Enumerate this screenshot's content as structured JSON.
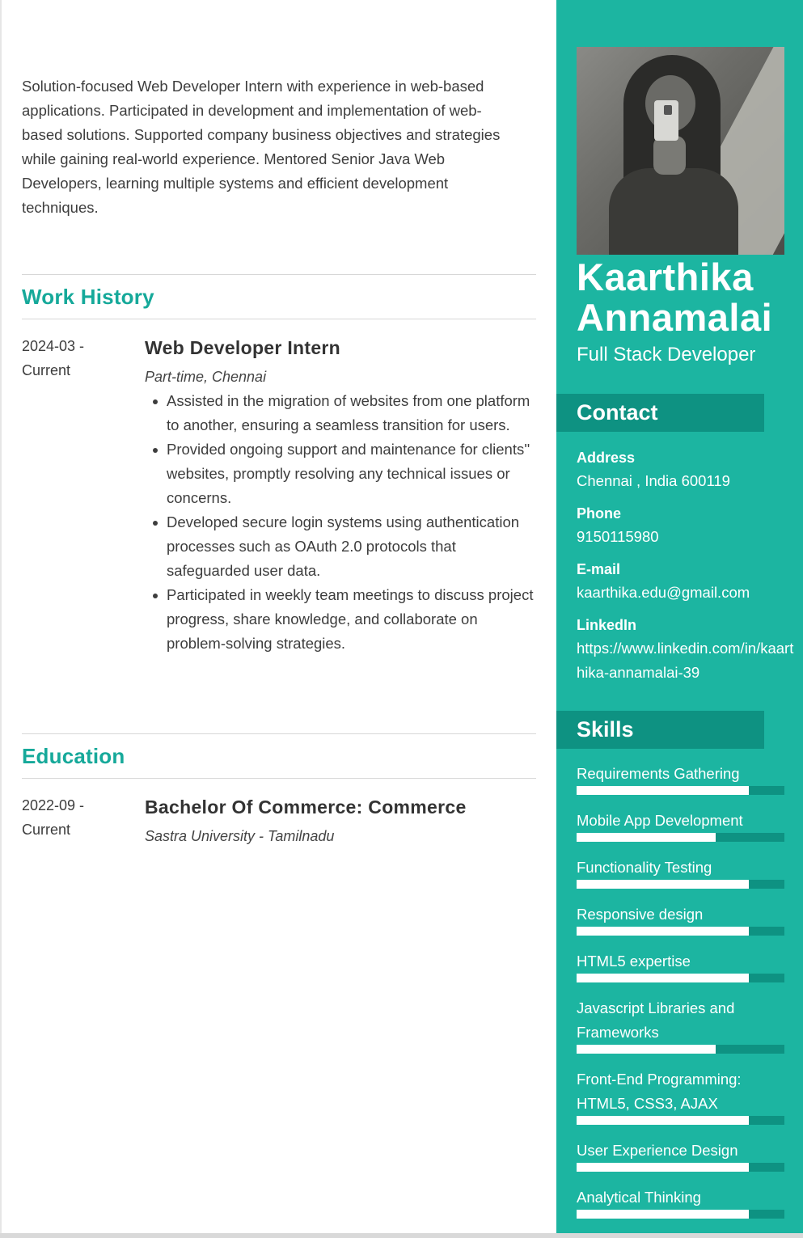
{
  "summary": "Solution-focused Web Developer Intern with experience in web-based applications. Participated in development and implementation of web-based solutions. Supported company business objectives and strategies while gaining real-world experience. Mentored Senior Java Web Developers, learning multiple systems and efficient development techniques.",
  "work": {
    "heading": "Work History",
    "date": "2024-03 - Current",
    "title": "Web Developer Intern",
    "subtitle": "Part-time, Chennai",
    "bullets": [
      "Assisted in the migration of websites from one platform to another, ensuring a seamless transition for users.",
      "Provided ongoing support and maintenance for clients'' websites, promptly resolving any technical issues or concerns.",
      "Developed secure login systems using authentication processes such as OAuth 2.0 protocols that safeguarded user data.",
      "Participated in weekly team meetings to discuss project progress, share knowledge, and collaborate on problem-solving strategies."
    ]
  },
  "education": {
    "heading": "Education",
    "date": "2022-09 - Current",
    "title": "Bachelor Of Commerce: Commerce",
    "subtitle": "Sastra University - Tamilnadu"
  },
  "profile": {
    "first_name": "Kaarthika",
    "last_name": "Annamalai",
    "role": "Full Stack Developer"
  },
  "contact": {
    "heading": "Contact",
    "address_label": "Address",
    "address": "Chennai , India 600119",
    "phone_label": "Phone",
    "phone": "9150115980",
    "email_label": "E-mail",
    "email": "kaarthika.edu@gmail.com",
    "linkedin_label": "LinkedIn",
    "linkedin": "https://www.linkedin.com/in/kaarthika-annamalai-39"
  },
  "skills": {
    "heading": "Skills",
    "items": [
      {
        "name": "Requirements Gathering",
        "level": 0.83
      },
      {
        "name": "Mobile App Development",
        "level": 0.67
      },
      {
        "name": "Functionality Testing",
        "level": 0.83
      },
      {
        "name": "Responsive design",
        "level": 0.83
      },
      {
        "name": "HTML5 expertise",
        "level": 0.83
      },
      {
        "name": "Javascript Libraries and Frameworks",
        "level": 0.67
      },
      {
        "name": "Front-End Programming: HTML5, CSS3, AJAX",
        "level": 0.83
      },
      {
        "name": "User Experience Design",
        "level": 0.83
      },
      {
        "name": "Analytical Thinking",
        "level": 0.83
      }
    ]
  },
  "colors": {
    "accent": "#1cb5a1",
    "accent_dark": "#0e9282",
    "heading": "#16a99a"
  }
}
